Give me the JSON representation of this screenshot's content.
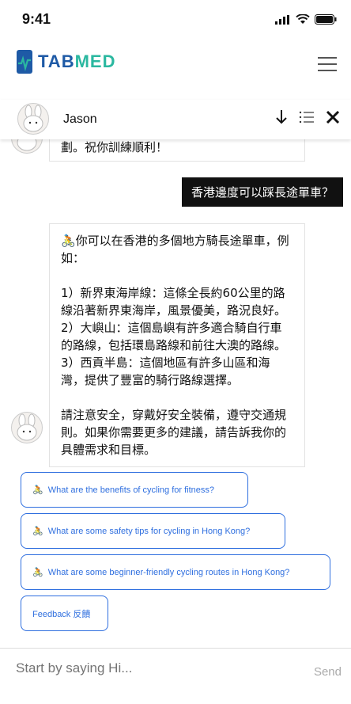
{
  "status_bar": {
    "time": "9:41"
  },
  "header": {
    "logo_text_tab": "TAB",
    "logo_text_med": "MED"
  },
  "chat": {
    "contact_name": "Jason",
    "messages": [
      {
        "role": "bot",
        "text": "劃。祝你訓練順利！"
      },
      {
        "role": "user",
        "text": "香港邊度可以踩長途單車？"
      },
      {
        "role": "bot",
        "paragraphs": [
          "🚴你可以在香港的多個地方騎長途單車，例如：",
          "1）新界東海岸線：這條全長約60公里的路線沿著新界東海岸，風景優美，路況良好。\n2）大嶼山：這個島嶼有許多適合騎自行車的路線，包括環島路線和前往大澳的路線。\n3）西貢半島：這個地區有許多山區和海灣，提供了豐富的騎行路線選擇。",
          "請注意安全，穿戴好安全裝備，遵守交通規則。如果你需要更多的建議，請告訴我你的具體需求和目標。"
        ]
      }
    ],
    "suggestions": [
      {
        "icon": "cyclist-icon",
        "label": "What are the benefits of cycling for fitness?"
      },
      {
        "icon": "cyclist-icon",
        "label": "What are some safety tips for cycling in Hong Kong?"
      },
      {
        "icon": "cyclist-icon",
        "label": "What are some beginner-friendly cycling routes in Hong Kong?"
      }
    ],
    "feedback_label": "Feedback 反饋"
  },
  "input": {
    "placeholder": "Start by saying Hi...",
    "send_label": "Send"
  }
}
